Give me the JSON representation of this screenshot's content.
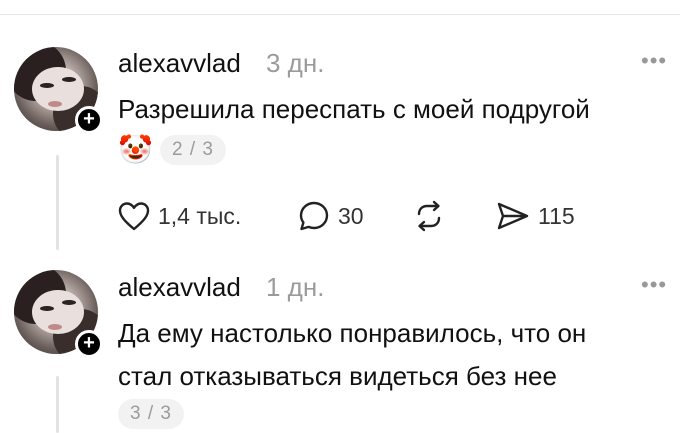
{
  "comments": [
    {
      "username": "alexavvlad",
      "time": "3 дн.",
      "text": "Разрешила переспать с моей подругой",
      "emoji": "🤡",
      "pager": "2 / 3",
      "actions": {
        "likes": "1,4 тыс.",
        "replies": "30",
        "shares": "115"
      }
    },
    {
      "username": "alexavvlad",
      "time": "1 дн.",
      "text_lines": [
        "Да ему настолько понравилось, что он",
        "стал отказываться видеться без нее"
      ],
      "pager": "3 / 3"
    }
  ],
  "icons": {
    "more": "more-dots-icon",
    "follow": "plus-icon",
    "like": "heart-icon",
    "reply": "comment-bubble-icon",
    "repost": "repost-icon",
    "share": "send-icon"
  }
}
